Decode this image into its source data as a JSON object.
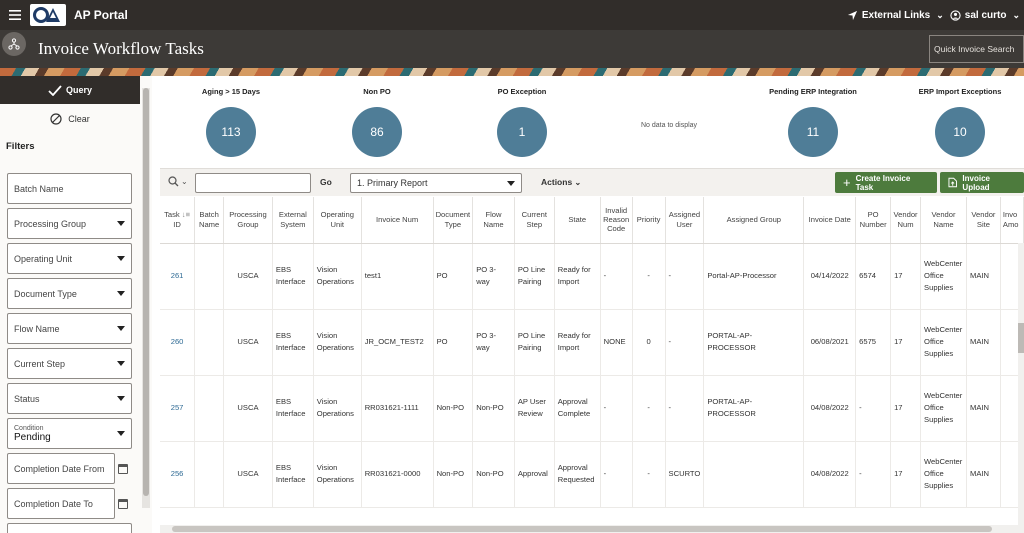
{
  "topbar": {
    "app_title": "AP Portal",
    "external_links": "External Links",
    "user_name": "sal curto"
  },
  "header": {
    "page_title": "Invoice Workflow Tasks",
    "quick_search_placeholder": "Quick Invoice Search"
  },
  "left": {
    "query_label": "Query",
    "clear_label": "Clear",
    "filters_label": "Filters",
    "fields": {
      "batch_name": "Batch Name",
      "processing_group": "Processing Group",
      "operating_unit": "Operating Unit",
      "document_type": "Document Type",
      "flow_name": "Flow Name",
      "current_step": "Current Step",
      "status": "Status",
      "condition_label": "Condition",
      "condition_value": "Pending",
      "completion_from": "Completion Date From",
      "completion_to": "Completion Date To"
    }
  },
  "kpis": [
    {
      "label": "Aging > 15 Days",
      "value": "113"
    },
    {
      "label": "Non PO",
      "value": "86"
    },
    {
      "label": "PO Exception",
      "value": "1"
    },
    {
      "label": "Pending ERP Integration",
      "value": "11"
    },
    {
      "label": "ERP Import Exceptions",
      "value": "10"
    }
  ],
  "no_data": "No data to display",
  "toolbar": {
    "go_label": "Go",
    "report_value": "1. Primary Report",
    "actions_label": "Actions",
    "create_label": "Create Invoice Task",
    "upload_label": "Invoice Upload"
  },
  "table": {
    "headers": {
      "task_id": [
        "Task",
        "ID"
      ],
      "batch_name": [
        "Batch",
        "Name"
      ],
      "processing_group": [
        "Processing",
        "Group"
      ],
      "external_system": [
        "External",
        "System"
      ],
      "operating_unit": [
        "Operating",
        "Unit"
      ],
      "invoice_num": "Invoice Num",
      "document_type": [
        "Document",
        "Type"
      ],
      "flow_name": [
        "Flow",
        "Name"
      ],
      "current_step": [
        "Current",
        "Step"
      ],
      "state": "State",
      "invalid_reason": [
        "Invalid",
        "Reason",
        "Code"
      ],
      "priority": "Priority",
      "assigned_user": [
        "Assigned",
        "User"
      ],
      "assigned_group": "Assigned Group",
      "invoice_date": "Invoice Date",
      "po_number": [
        "PO",
        "Number"
      ],
      "vendor_num": [
        "Vendor",
        "Num"
      ],
      "vendor_name": [
        "Vendor",
        "Name"
      ],
      "vendor_site": [
        "Vendor",
        "Site"
      ],
      "invoice_amount": [
        "Invo",
        "Amo"
      ]
    },
    "rows": [
      {
        "task_id": "261",
        "batch_name": "",
        "processing_group": "USCA",
        "external_system": [
          "EBS",
          "Interface"
        ],
        "operating_unit": [
          "Vision",
          "Operations"
        ],
        "invoice_num": "test1",
        "document_type": "PO",
        "flow_name": [
          "PO 3-",
          "way"
        ],
        "current_step": [
          "PO Line",
          "Pairing"
        ],
        "state": [
          "Ready for",
          "Import"
        ],
        "invalid_reason": "-",
        "priority": "-",
        "assigned_user": "-",
        "assigned_group": "Portal-AP-Processor",
        "invoice_date": "04/14/2022",
        "po_number": "6574",
        "vendor_num": "17",
        "vendor_name": [
          "WebCenter",
          "Office",
          "Supplies"
        ],
        "vendor_site": "MAIN"
      },
      {
        "task_id": "260",
        "batch_name": "",
        "processing_group": "USCA",
        "external_system": [
          "EBS",
          "Interface"
        ],
        "operating_unit": [
          "Vision",
          "Operations"
        ],
        "invoice_num": "JR_OCM_TEST2",
        "document_type": "PO",
        "flow_name": [
          "PO 3-",
          "way"
        ],
        "current_step": [
          "PO Line",
          "Pairing"
        ],
        "state": [
          "Ready for",
          "Import"
        ],
        "invalid_reason": "NONE",
        "priority": "0",
        "assigned_user": "-",
        "assigned_group": "PORTAL-AP-PROCESSOR",
        "invoice_date": "06/08/2021",
        "po_number": "6575",
        "vendor_num": "17",
        "vendor_name": [
          "WebCenter",
          "Office",
          "Supplies"
        ],
        "vendor_site": "MAIN"
      },
      {
        "task_id": "257",
        "batch_name": "",
        "processing_group": "USCA",
        "external_system": [
          "EBS",
          "Interface"
        ],
        "operating_unit": [
          "Vision",
          "Operations"
        ],
        "invoice_num": "RR031621-1111",
        "document_type": "Non-PO",
        "flow_name": [
          "Non-PO"
        ],
        "current_step": [
          "AP User",
          "Review"
        ],
        "state": [
          "Approval",
          "Complete"
        ],
        "invalid_reason": "-",
        "priority": "-",
        "assigned_user": "-",
        "assigned_group": "PORTAL-AP-PROCESSOR",
        "invoice_date": "04/08/2022",
        "po_number": "-",
        "vendor_num": "17",
        "vendor_name": [
          "WebCenter",
          "Office",
          "Supplies"
        ],
        "vendor_site": "MAIN"
      },
      {
        "task_id": "256",
        "batch_name": "",
        "processing_group": "USCA",
        "external_system": [
          "EBS",
          "Interface"
        ],
        "operating_unit": [
          "Vision",
          "Operations"
        ],
        "invoice_num": "RR031621-0000",
        "document_type": "Non-PO",
        "flow_name": [
          "Non-PO"
        ],
        "current_step": [
          "Approval"
        ],
        "state": [
          "Approval",
          "Requested"
        ],
        "invalid_reason": "-",
        "priority": "-",
        "assigned_user": "SCURTO",
        "assigned_group": "",
        "invoice_date": "04/08/2022",
        "po_number": "-",
        "vendor_num": "17",
        "vendor_name": [
          "WebCenter",
          "Office",
          "Supplies"
        ],
        "vendor_site": "MAIN"
      }
    ]
  },
  "colors": {
    "kpi_circle": "#4f7d97",
    "topbar": "#312d2a",
    "green_button": "#4d7b3d",
    "link": "#2e6a94"
  }
}
